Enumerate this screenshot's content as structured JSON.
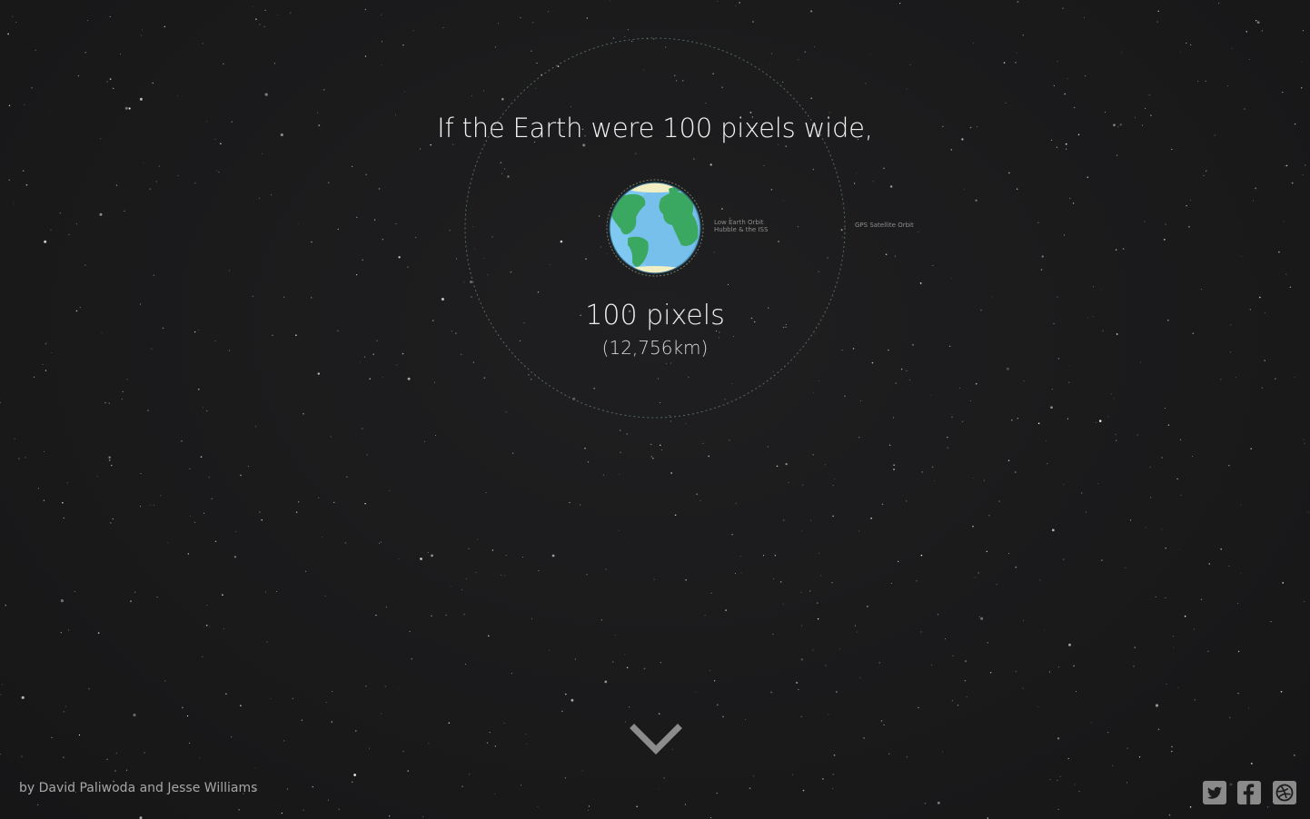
{
  "headline": "If the Earth were 100 pixels wide,",
  "earth": {
    "size_label": "100 pixels",
    "real_size_label": "(12,756km)",
    "ocean_color": "#7fc8f2",
    "land_color": "#3aa860",
    "ice_color": "#f3efc5"
  },
  "orbits": {
    "low_earth_orbit_line1": "Low Earth Orbit",
    "low_earth_orbit_line2": "Hubble & the ISS",
    "gps_orbit": "GPS Satellite Orbit"
  },
  "navigation": {
    "scroll_down_icon": "chevron-down-icon"
  },
  "footer": {
    "credit": "by David Paliwoda and Jesse Williams",
    "social_icons": [
      "twitter-icon",
      "facebook-icon",
      "dribbble-icon"
    ]
  },
  "colors": {
    "background": "#1b1b1c",
    "text": "#f2f2f2",
    "orbit_line": "#5a6e70",
    "icon": "#8a8a8a"
  }
}
